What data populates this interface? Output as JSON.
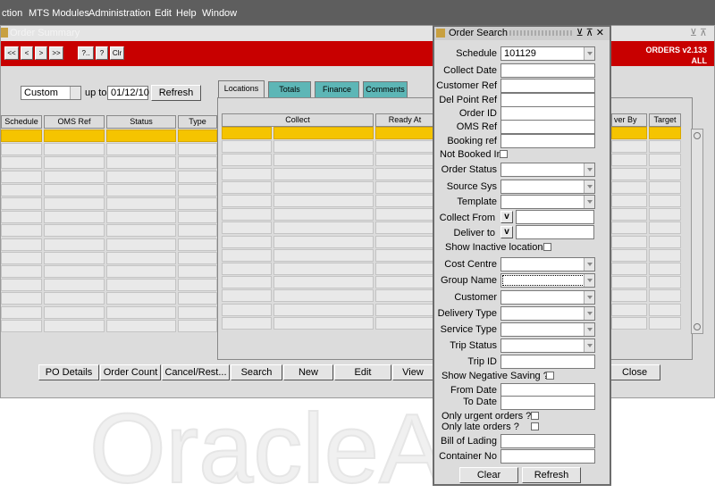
{
  "menu": {
    "items": [
      "ction",
      "MTS Modules",
      "Administration",
      "Edit",
      "Help",
      "Window"
    ]
  },
  "watermark": {
    "text": "OracleAS"
  },
  "order_summary": {
    "title": "Order Summary",
    "version": {
      "line1": "ORDERS v2.133",
      "line2": "ALL"
    },
    "toolbar": {
      "first": "<<",
      "prev": "<",
      "next": ">",
      "last": ">>",
      "query": "?..",
      "help": "?",
      "clear": "Clr"
    },
    "filter": {
      "mode": "Custom",
      "up_to_label": "up to",
      "date": "01/12/10",
      "refresh": "Refresh"
    },
    "columns_left": [
      "Schedule",
      "OMS Ref",
      "Status",
      "Type"
    ],
    "tabs": [
      "Locations",
      "Totals",
      "Finance",
      "Comments"
    ],
    "columns_right": [
      "Collect",
      "Ready At"
    ],
    "columns_far": [
      "ver By",
      "Target"
    ],
    "buttons": {
      "po_details": "PO Details",
      "order_count": "Order Count",
      "cancel_rest": "Cancel/Rest...",
      "search": "Search",
      "new": "New",
      "edit": "Edit",
      "view": "View",
      "close": "Close"
    }
  },
  "order_search": {
    "title": "Order Search",
    "controls": "⊻ ⊼ ✕",
    "schedule": {
      "label": "Schedule",
      "value": "101129"
    },
    "collect_date": "Collect Date",
    "customer_ref": "Customer Ref",
    "del_point_ref": "Del Point Ref",
    "order_id": "Order ID",
    "oms_ref": "OMS Ref",
    "booking_ref": "Booking ref",
    "not_booked_in": "Not Booked In",
    "order_status": "Order Status",
    "source_sys": "Source Sys",
    "template": "Template",
    "collect_from": "Collect From",
    "deliver_to": "Deliver to",
    "v_button": "v",
    "show_inactive": "Show Inactive locations",
    "cost_centre": "Cost Centre",
    "group_name": "Group Name",
    "customer": "Customer",
    "delivery_type": "Delivery Type",
    "service_type": "Service Type",
    "trip_status": "Trip Status",
    "trip_id": "Trip ID",
    "show_negative_saving": "Show Negative Saving ?",
    "from_date": "From Date",
    "to_date": "To Date",
    "only_urgent": "Only urgent orders ?",
    "only_late": "Only late orders ?",
    "bill_of_lading": "Bill of Lading",
    "container_no": "Container No",
    "clear": "Clear",
    "refresh": "Refresh"
  }
}
